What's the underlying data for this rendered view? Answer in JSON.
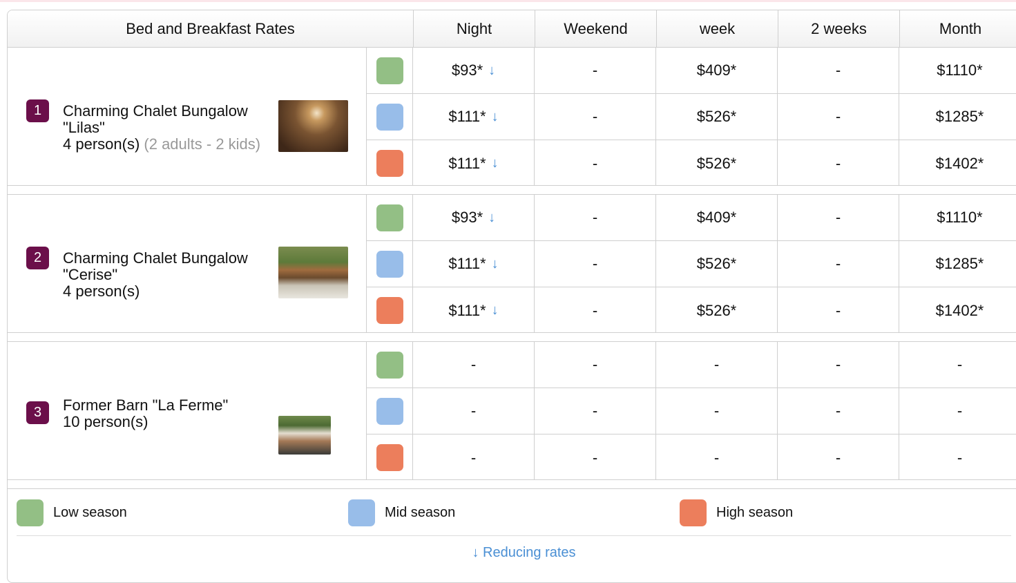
{
  "header": {
    "title": "Bed and Breakfast Rates",
    "columns": [
      "Night",
      "Weekend",
      "week",
      "2 weeks",
      "Month"
    ]
  },
  "colors": {
    "low": "#93bf85",
    "mid": "#98bde9",
    "high": "#ec7e5c",
    "badge": "#6b0f4a",
    "link": "#4a8fd4"
  },
  "properties": [
    {
      "number": "1",
      "name": "Charming Chalet Bungalow \"Lilas\"",
      "capacity": "4 person(s)",
      "detail": "(2 adults - 2 kids)",
      "rows": [
        {
          "night": "$93*",
          "arrow": "↓",
          "weekend": "-",
          "week": "$409*",
          "two_weeks": "-",
          "month": "$1110*"
        },
        {
          "night": "$111*",
          "arrow": "↓",
          "weekend": "-",
          "week": "$526*",
          "two_weeks": "-",
          "month": "$1285*"
        },
        {
          "night": "$111*",
          "arrow": "↓",
          "weekend": "-",
          "week": "$526*",
          "two_weeks": "-",
          "month": "$1402*"
        }
      ]
    },
    {
      "number": "2",
      "name": "Charming Chalet Bungalow \"Cerise\"",
      "capacity": "4 person(s)",
      "detail": "",
      "rows": [
        {
          "night": "$93*",
          "arrow": "↓",
          "weekend": "-",
          "week": "$409*",
          "two_weeks": "-",
          "month": "$1110*"
        },
        {
          "night": "$111*",
          "arrow": "↓",
          "weekend": "-",
          "week": "$526*",
          "two_weeks": "-",
          "month": "$1285*"
        },
        {
          "night": "$111*",
          "arrow": "↓",
          "weekend": "-",
          "week": "$526*",
          "two_weeks": "-",
          "month": "$1402*"
        }
      ]
    },
    {
      "number": "3",
      "name": "Former Barn \"La Ferme\"",
      "capacity": "10 person(s)",
      "detail": "",
      "rows": [
        {
          "night": "-",
          "arrow": "",
          "weekend": "-",
          "week": "-",
          "two_weeks": "-",
          "month": "-"
        },
        {
          "night": "-",
          "arrow": "",
          "weekend": "-",
          "week": "-",
          "two_weeks": "-",
          "month": "-"
        },
        {
          "night": "-",
          "arrow": "",
          "weekend": "-",
          "week": "-",
          "two_weeks": "-",
          "month": "-"
        }
      ]
    }
  ],
  "legend": {
    "low": "Low season",
    "mid": "Mid season",
    "high": "High season",
    "reducing_arrow": "↓",
    "reducing": "Reducing rates"
  }
}
